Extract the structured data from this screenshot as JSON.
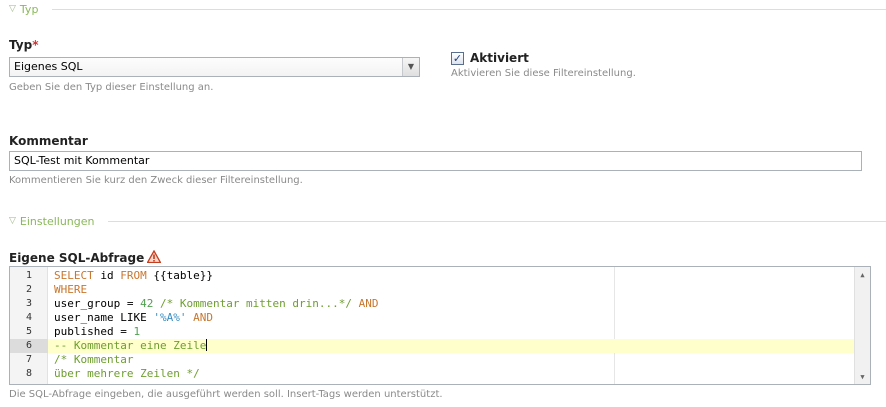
{
  "sections": {
    "typ": "Typ",
    "einstellungen": "Einstellungen"
  },
  "typ_field": {
    "label": "Typ",
    "required_mark": "*",
    "value": "Eigenes SQL",
    "help": "Geben Sie den Typ dieser Einstellung an."
  },
  "aktiviert": {
    "label": "Aktiviert",
    "checked": true,
    "help": "Aktivieren Sie diese Filtereinstellung."
  },
  "kommentar": {
    "label": "Kommentar",
    "value": "SQL-Test mit Kommentar",
    "help": "Kommentieren Sie kurz den Zweck dieser Filtereinstellung."
  },
  "sql": {
    "label": "Eigene SQL-Abfrage",
    "help": "Die SQL-Abfrage eingeben, die ausgeführt werden soll. Insert-Tags werden unterstützt.",
    "active_line": 6,
    "line_numbers": [
      "1",
      "2",
      "3",
      "4",
      "5",
      "6",
      "7",
      "8"
    ],
    "lines": [
      [
        {
          "t": "SELECT",
          "c": "kw"
        },
        {
          "t": " id ",
          "c": ""
        },
        {
          "t": "FROM",
          "c": "kw"
        },
        {
          "t": " {{table}}",
          "c": ""
        }
      ],
      [
        {
          "t": "WHERE",
          "c": "kw"
        }
      ],
      [
        {
          "t": "user_group = ",
          "c": ""
        },
        {
          "t": "42",
          "c": "num-lit"
        },
        {
          "t": " ",
          "c": ""
        },
        {
          "t": "/* Kommentar mitten drin...*/",
          "c": "cm"
        },
        {
          "t": " ",
          "c": ""
        },
        {
          "t": "AND",
          "c": "kw"
        }
      ],
      [
        {
          "t": "user_name LIKE ",
          "c": ""
        },
        {
          "t": "'%A%'",
          "c": "str"
        },
        {
          "t": " ",
          "c": ""
        },
        {
          "t": "AND",
          "c": "kw"
        }
      ],
      [
        {
          "t": "published = ",
          "c": ""
        },
        {
          "t": "1",
          "c": "num-lit"
        }
      ],
      [
        {
          "t": "-- Kommentar eine Zeile",
          "c": "cm"
        }
      ],
      [
        {
          "t": "/* Kommentar",
          "c": "cm"
        }
      ],
      [
        {
          "t": "über mehrere Zeilen */",
          "c": "cm"
        }
      ]
    ]
  }
}
